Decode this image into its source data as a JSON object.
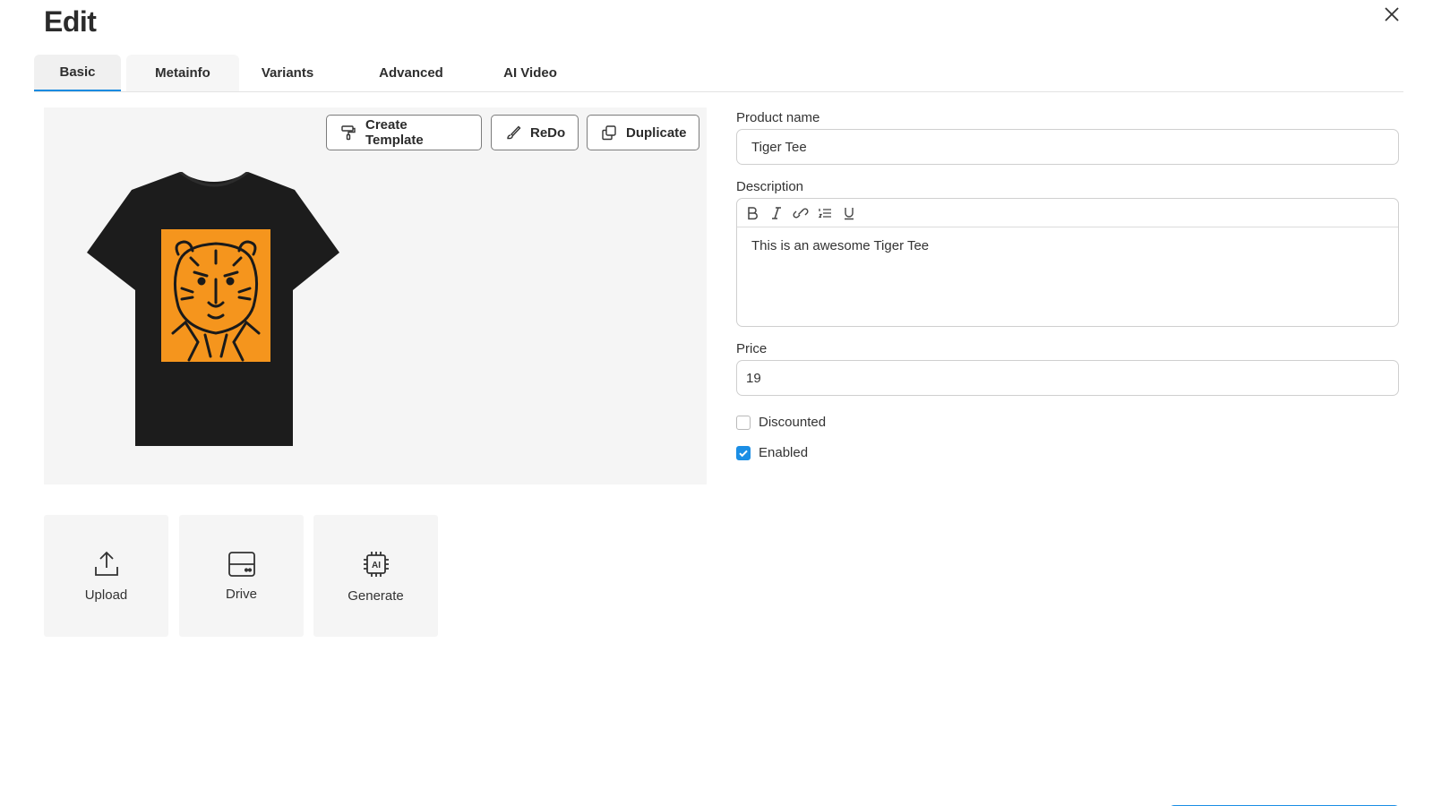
{
  "dialog": {
    "title": "Edit"
  },
  "tabs": [
    {
      "label": "Basic",
      "active": true
    },
    {
      "label": "Metainfo",
      "active": false
    },
    {
      "label": "Variants",
      "active": false
    },
    {
      "label": "Advanced",
      "active": false
    },
    {
      "label": "AI Video",
      "active": false
    }
  ],
  "preview": {
    "actions": {
      "create_template": "Create Template",
      "redo": "ReDo",
      "duplicate": "Duplicate"
    },
    "image": "tiger-tee-mockup"
  },
  "sources": {
    "upload": "Upload",
    "drive": "Drive",
    "generate": "Generate"
  },
  "form": {
    "product_name_label": "Product name",
    "product_name_value": "Tiger Tee",
    "description_label": "Description",
    "description_value": "This is an awesome Tiger Tee",
    "toolbar_icons": [
      "bold-icon",
      "italic-icon",
      "link-icon",
      "list-icon",
      "underline-icon"
    ],
    "price_label": "Price",
    "price_value": "19",
    "discounted_label": "Discounted",
    "discounted_checked": false,
    "enabled_label": "Enabled",
    "enabled_checked": true
  },
  "colors": {
    "accent": "#1b8ee5",
    "tee": "#1c1c1c",
    "print": "#f5951d"
  }
}
